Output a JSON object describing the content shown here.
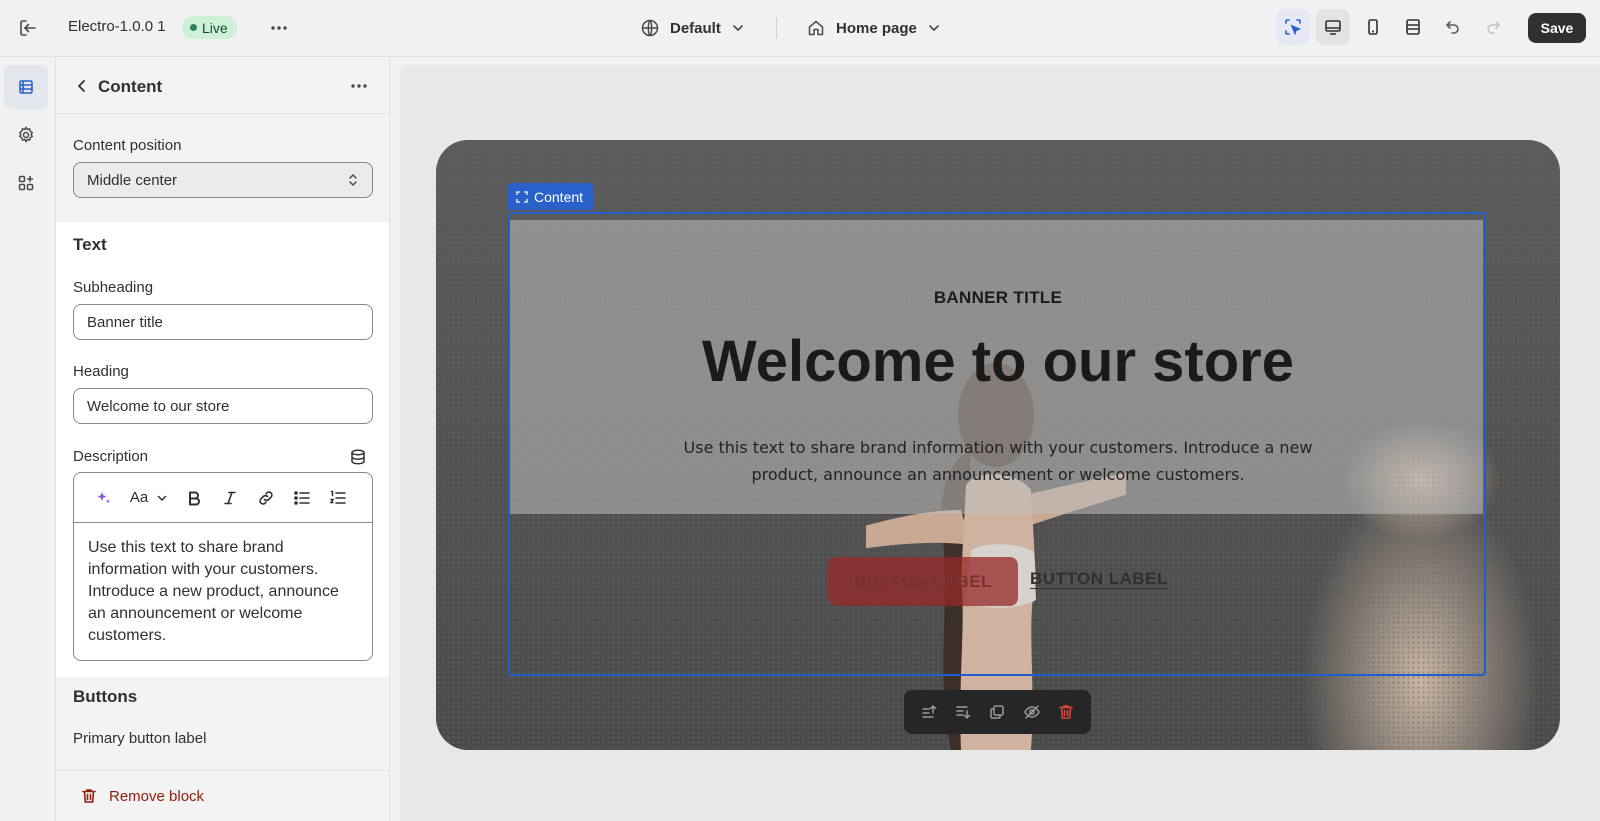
{
  "topbar": {
    "theme_name": "Electro-1.0.0 1",
    "status": "Live",
    "locale": "Default",
    "page": "Home page",
    "save_label": "Save"
  },
  "panel": {
    "title": "Content",
    "content_position_label": "Content position",
    "content_position_value": "Middle center",
    "text_section_title": "Text",
    "subheading_label": "Subheading",
    "subheading_value": "Banner title",
    "heading_label": "Heading",
    "heading_value": "Welcome to our store",
    "description_label": "Description",
    "description_value": "Use this text to share brand information with your customers. Introduce a new product, announce an announcement or welcome customers.",
    "buttons_section_title": "Buttons",
    "primary_button_label": "Primary button label",
    "remove_block_label": "Remove block"
  },
  "canvas": {
    "content_tag": "Content",
    "banner_subheading": "BANNER TITLE",
    "banner_heading": "Welcome to our store",
    "banner_description": "Use this text to share brand information with your customers. Introduce a new product, announce an announcement or welcome customers.",
    "button_primary": "BUTTON LABEL",
    "button_secondary": "BUTTON LABEL"
  },
  "colors": {
    "accent": "#2a60c9",
    "live_badge_bg": "#cdf0d6",
    "danger": "#8e1f0b",
    "save_bg": "#303030"
  }
}
